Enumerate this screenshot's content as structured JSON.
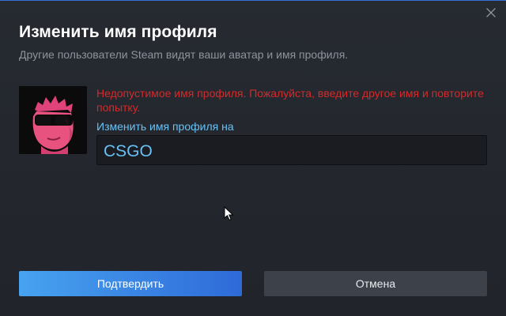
{
  "dialog": {
    "title": "Изменить имя профиля",
    "subtitle": "Другие пользователи Steam видят ваши аватар и имя профиля.",
    "close_icon": "close-icon"
  },
  "form": {
    "error_message": "Недопустимое имя профиля. Пожалуйста, введите другое имя и повторите попытку.",
    "field_label": "Изменить имя профиля на",
    "name_value": "CSGO"
  },
  "buttons": {
    "confirm_label": "Подтвердить",
    "cancel_label": "Отмена"
  },
  "colors": {
    "accent_blue": "#67c1f5",
    "error_red": "#d42a2a",
    "confirm_start": "#47a3f0",
    "confirm_end": "#2e6ad8",
    "cancel_bg": "#3c414a",
    "background": "#23262c"
  }
}
